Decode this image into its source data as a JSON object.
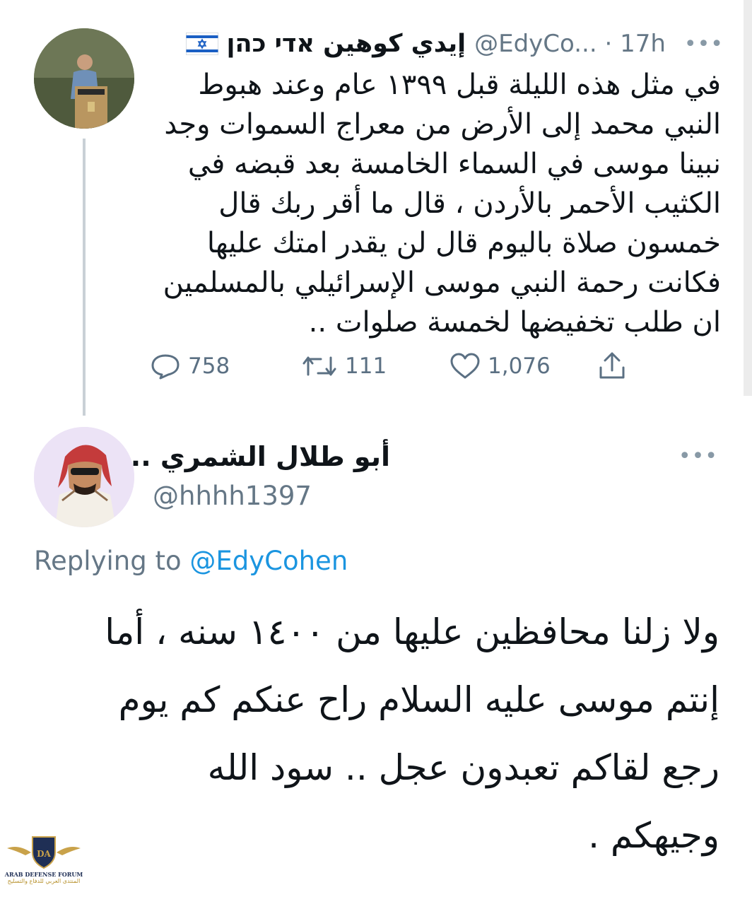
{
  "tweet1": {
    "author_name": "إيدي كوهين אדי כהן",
    "handle_time": "@EdyCo... · 17h",
    "more_label": "•••",
    "text": "في مثل هذه الليلة قبل ١٣٩٩ عام وعند هبوط\nالنبي محمد إلى الأرض من معراج السموات وجد\nنبينا موسى في السماء الخامسة بعد قبضه في\nالكثيب الأحمر بالأردن ، قال ما أقر ربك قال\nخمسون صلاة باليوم قال لن يقدر امتك عليها\nفكانت رحمة النبي موسى الإسرائيلي بالمسلمين\nان طلب تخفيضها لخمسة صلوات ..",
    "flag_icon": "israel-flag-icon",
    "stats": {
      "replies": "758",
      "retweets": "111",
      "likes": "1,076"
    },
    "icons": [
      "reply-icon",
      "retweet-icon",
      "like-icon",
      "share-icon"
    ]
  },
  "tweet2": {
    "author_name": "أبو طلال الشمري ..",
    "handle": "@hhhh1397",
    "more_label": "•••",
    "replying_prefix": "Replying to",
    "replying_to": "@EdyCohen",
    "text": "ولا زلنا محافظين عليها من ١٤٠٠ سنه ، أما\nإنتم موسى عليه السلام راح عنكم كم يوم\nرجع لقاكم تعبدون عجل .. سود الله\nوجيهكم ."
  },
  "watermark": {
    "initials": "DA",
    "name": "ARAB DEFENSE FORUM",
    "name_ar": "المنتدى العربي للدفاع والتسليح"
  },
  "colors": {
    "text": "#0f1419",
    "secondary": "#657786",
    "link": "#1b95e0",
    "thread_line": "#c9d0d6"
  }
}
